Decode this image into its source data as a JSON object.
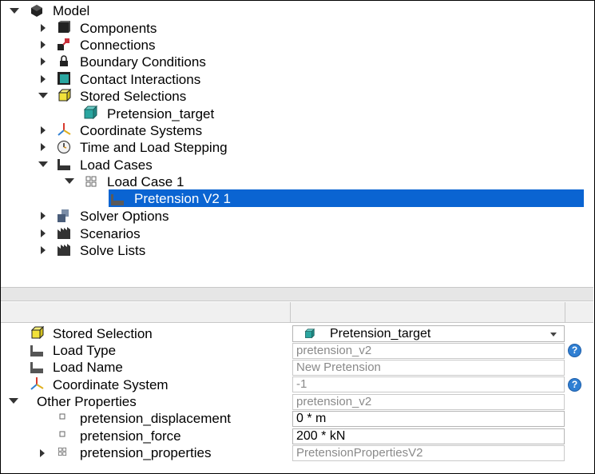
{
  "tree": {
    "root": {
      "label": "Model",
      "icon": "model-icon"
    },
    "items": [
      {
        "label": "Components",
        "icon": "components-icon",
        "expanded": false
      },
      {
        "label": "Connections",
        "icon": "connections-icon",
        "expanded": false
      },
      {
        "label": "Boundary Conditions",
        "icon": "lock-icon",
        "expanded": false
      },
      {
        "label": "Contact Interactions",
        "icon": "contact-icon",
        "expanded": false
      },
      {
        "label": "Stored Selections",
        "icon": "stored-selection-icon",
        "expanded": true
      },
      {
        "label": "Pretension_target",
        "icon": "selection-cube-icon"
      },
      {
        "label": "Coordinate Systems",
        "icon": "coordinate-axes-icon",
        "expanded": false
      },
      {
        "label": "Time and Load Stepping",
        "icon": "clock-icon",
        "expanded": false
      },
      {
        "label": "Load Cases",
        "icon": "load-icon",
        "expanded": true
      },
      {
        "label": "Load Case 1",
        "icon": "grid-icon",
        "expanded": true
      },
      {
        "label": "Pretension V2 1",
        "icon": "load-icon",
        "selected": true
      },
      {
        "label": "Solver Options",
        "icon": "solver-icon",
        "expanded": false
      },
      {
        "label": "Scenarios",
        "icon": "scenario-icon",
        "expanded": false
      },
      {
        "label": "Solve Lists",
        "icon": "scenario-icon",
        "expanded": false
      }
    ]
  },
  "properties": {
    "stored_selection": {
      "label": "Stored Selection",
      "value": "Pretension_target"
    },
    "load_type": {
      "label": "Load Type",
      "value": "pretension_v2"
    },
    "load_name": {
      "label": "Load Name",
      "value": "New Pretension"
    },
    "coordinate_system": {
      "label": "Coordinate System",
      "value": "-1"
    },
    "other_properties": {
      "label": "Other Properties",
      "value": "pretension_v2"
    },
    "pretension_displacement": {
      "label": "pretension_displacement",
      "value": "0 * m"
    },
    "pretension_force": {
      "label": "pretension_force",
      "value": "200 * kN"
    },
    "pretension_properties": {
      "label": "pretension_properties",
      "value": "PretensionPropertiesV2"
    }
  },
  "help_glyph": "?",
  "colors": {
    "selection": "#0a64d2",
    "help": "#2f7fd3",
    "teal": "#2aa6a0",
    "yellow": "#f2e23a"
  }
}
